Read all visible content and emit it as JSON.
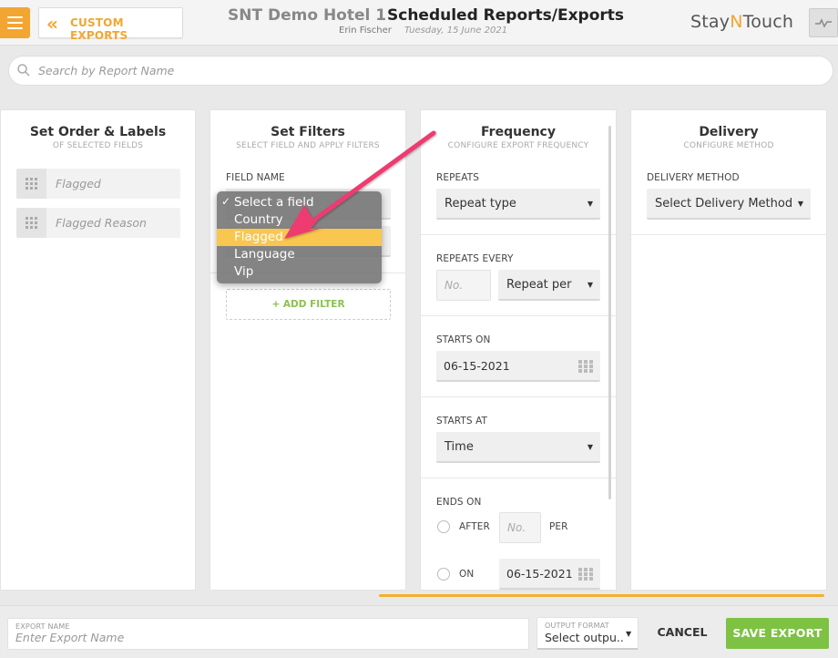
{
  "header": {
    "back_label": "CUSTOM EXPORTS",
    "hotel_name": "SNT Demo Hotel 1",
    "page_title": "Scheduled Reports/Exports",
    "user_name": "Erin Fischer",
    "date": "Tuesday, 15 June 2021",
    "brand": {
      "part1": "Stay",
      "part2": "N",
      "part3": "Touch"
    }
  },
  "search": {
    "placeholder": "Search by Report Name"
  },
  "order_panel": {
    "title": "Set Order & Labels",
    "subtitle": "OF SELECTED FIELDS",
    "fields": [
      "Flagged",
      "Flagged Reason"
    ]
  },
  "filters_panel": {
    "title": "Set Filters",
    "subtitle": "SELECT FIELD AND APPLY FILTERS",
    "field_name_label": "FIELD NAME",
    "add_filter_label": "+ ADD FILTER",
    "dropdown_options": [
      "Select a field",
      "Country",
      "Flagged",
      "Language",
      "Vip"
    ],
    "selected_option": "Select a field",
    "highlighted_option": "Flagged"
  },
  "frequency_panel": {
    "title": "Frequency",
    "subtitle": "CONFIGURE EXPORT FREQUENCY",
    "repeats_label": "REPEATS",
    "repeats_value": "Repeat type",
    "repeats_every_label": "REPEATS EVERY",
    "repeats_every_placeholder": "No.",
    "repeat_per_value": "Repeat per",
    "starts_on_label": "STARTS ON",
    "starts_on_value": "06-15-2021",
    "starts_at_label": "STARTS AT",
    "starts_at_value": "Time",
    "ends_on_label": "ENDS ON",
    "after_label": "AFTER",
    "after_placeholder": "No.",
    "per_label": "PER",
    "on_label": "ON",
    "ends_on_date": "06-15-2021"
  },
  "delivery_panel": {
    "title": "Delivery",
    "subtitle": "CONFIGURE METHOD",
    "method_label": "DELIVERY METHOD",
    "method_value": "Select Delivery Method"
  },
  "footer": {
    "export_name_label": "EXPORT NAME",
    "export_name_placeholder": "Enter Export Name",
    "output_format_label": "OUTPUT FORMAT",
    "output_format_value": "Select outpu..",
    "cancel_label": "CANCEL",
    "save_label": "SAVE EXPORT"
  },
  "colors": {
    "accent": "#f3a531",
    "save_green": "#7dc242",
    "highlight": "#f9c64f",
    "annotation_arrow": "#ee3a70"
  }
}
